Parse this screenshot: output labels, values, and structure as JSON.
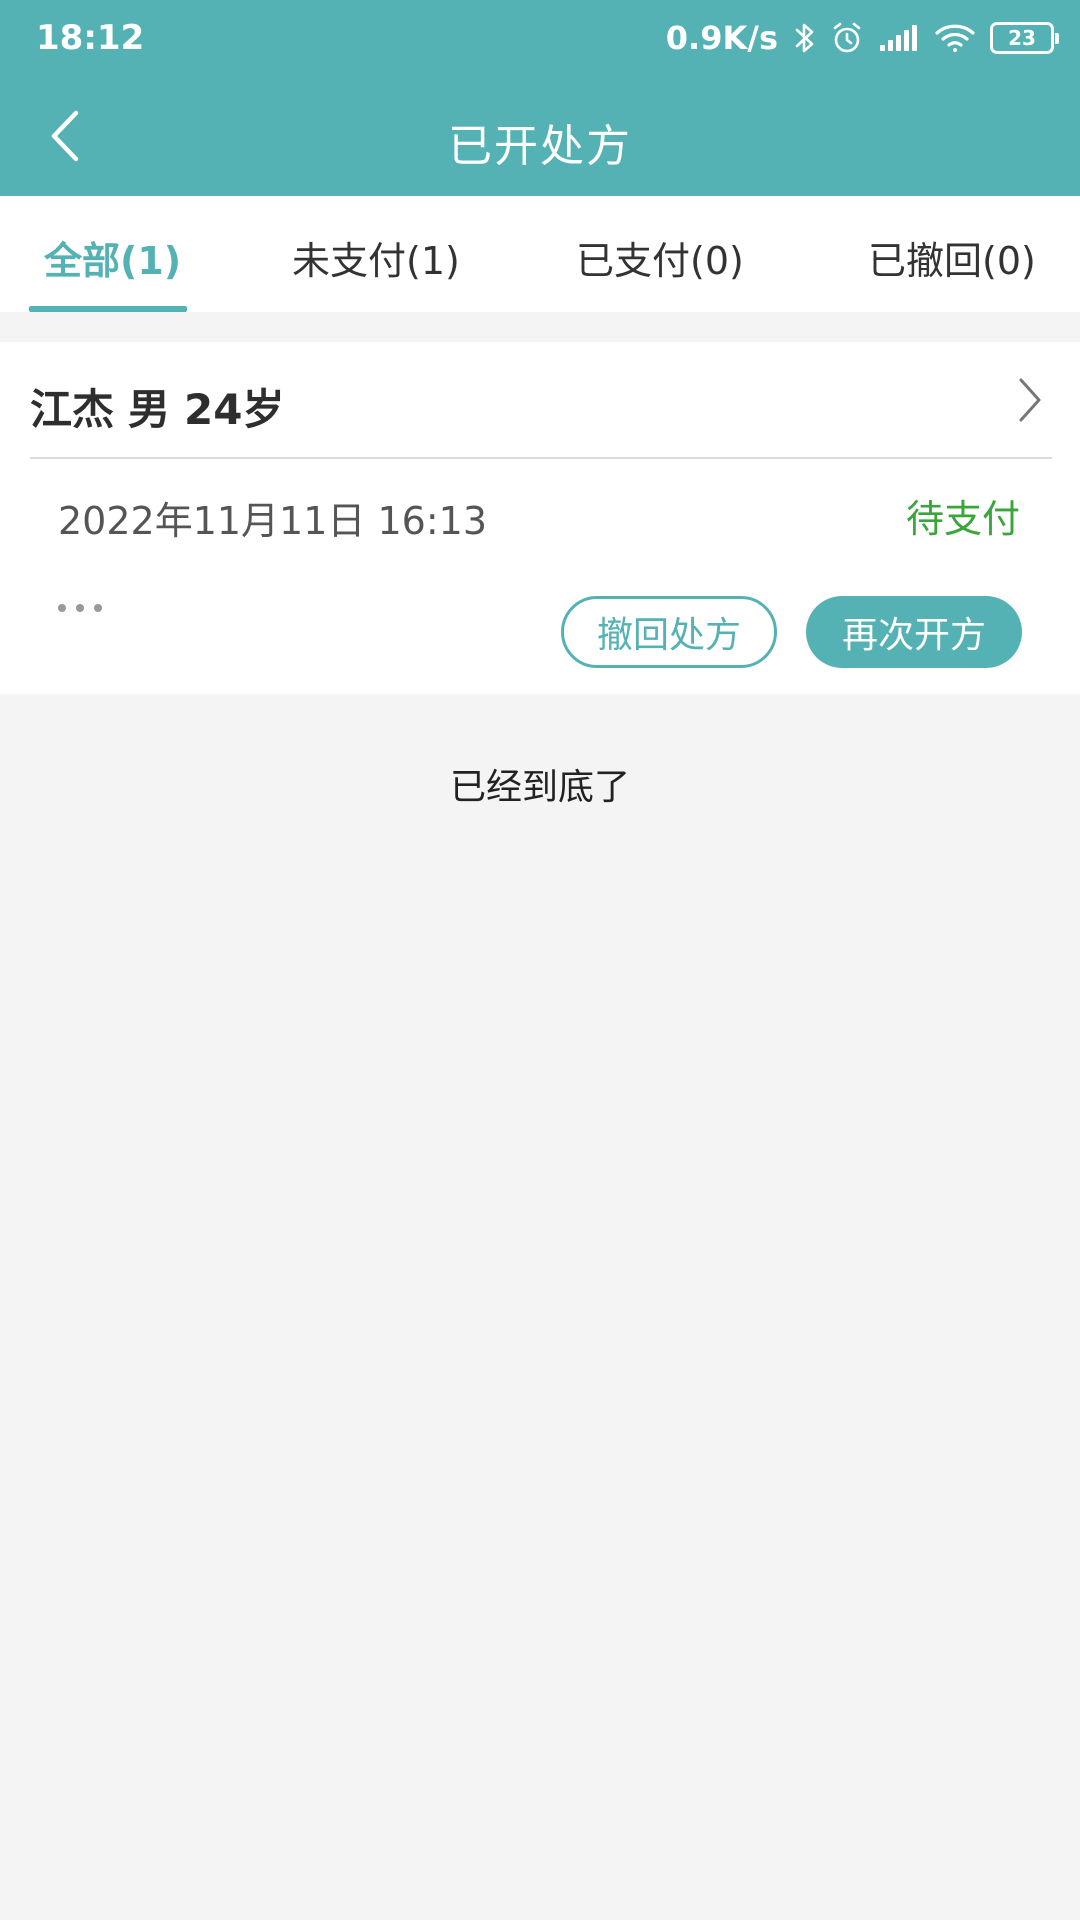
{
  "status_bar": {
    "time": "18:12",
    "net_speed": "0.9K/s",
    "battery": "23",
    "icons": [
      "bluetooth-icon",
      "alarm-icon",
      "signal-icon",
      "wifi-icon",
      "battery-icon"
    ]
  },
  "header": {
    "title": "已开处方",
    "back_icon": "chevron-left-icon"
  },
  "tabs": [
    {
      "label": "全部(1)",
      "active": true
    },
    {
      "label": "未支付(1)",
      "active": false
    },
    {
      "label": "已支付(0)",
      "active": false
    },
    {
      "label": "已撤回(0)",
      "active": false
    }
  ],
  "prescription": {
    "patient_name": "江杰",
    "gender": "男",
    "age": "24岁",
    "datetime": "2022年11月11日 16:13",
    "status": "待支付",
    "withdraw_label": "撤回处方",
    "represcribe_label": "再次开方"
  },
  "list_end_text": "已经到底了",
  "colors": {
    "primary": "#55b2b4",
    "status_pending": "#3aa63a",
    "background": "#f4f4f4"
  }
}
